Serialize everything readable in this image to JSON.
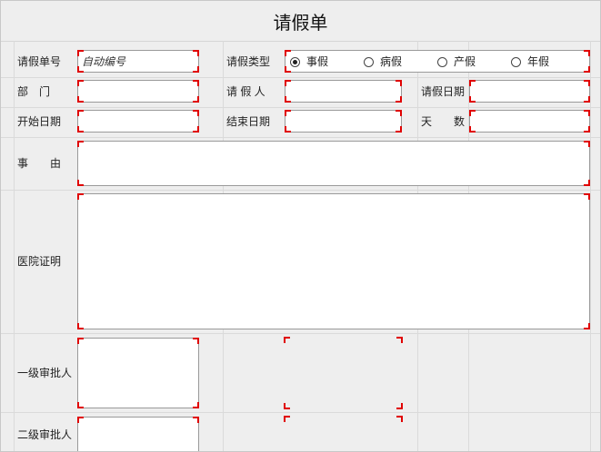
{
  "form": {
    "title": "请假单",
    "labels": {
      "leave_no": "请假单号",
      "leave_type": "请假类型",
      "department": "部　门",
      "applicant": "请 假 人",
      "apply_date": "请假日期",
      "start_date": "开始日期",
      "end_date": "结束日期",
      "days": "天　　数",
      "reason": "事　　由",
      "hospital_cert": "医院证明",
      "approver_1": "一级审批人",
      "approver_2": "二级审批人"
    },
    "fields": {
      "leave_no_placeholder": "自动编号"
    },
    "leave_type": {
      "options": [
        "事假",
        "病假",
        "产假",
        "年假"
      ],
      "selected": "事假"
    }
  }
}
